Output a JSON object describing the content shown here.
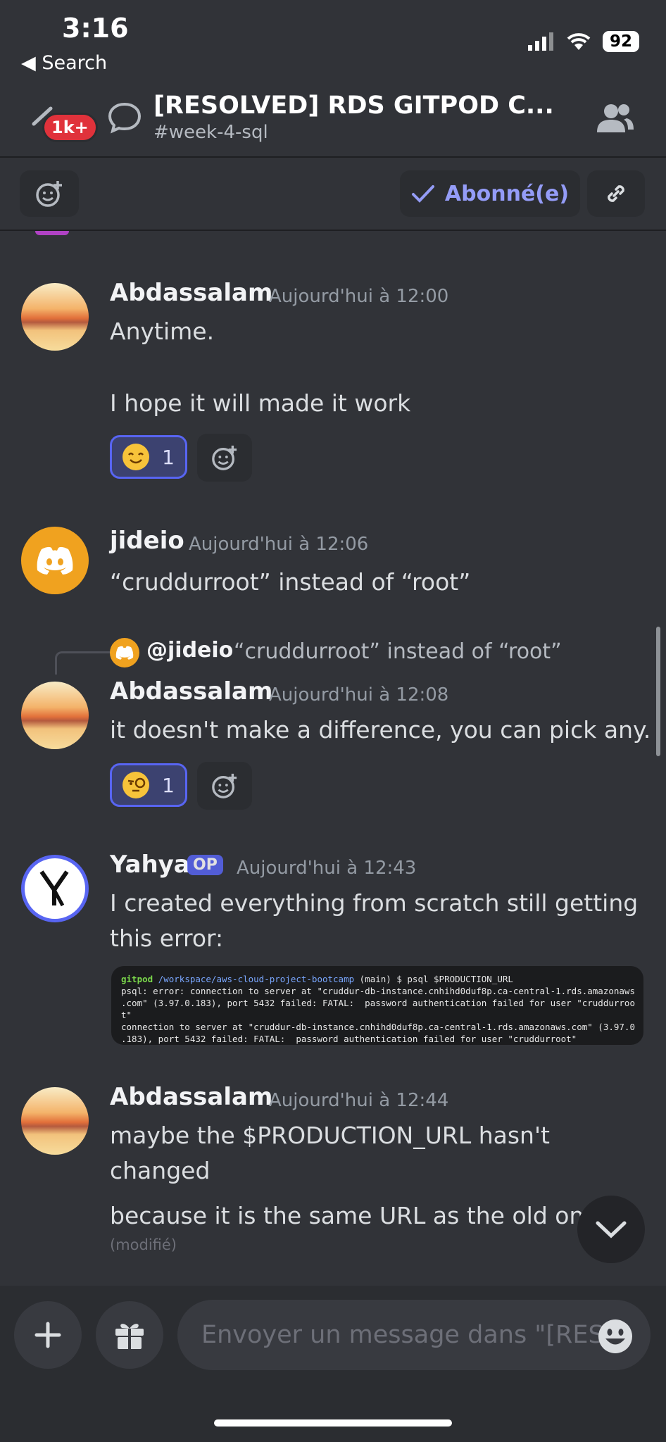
{
  "status_bar": {
    "time": "3:16",
    "back_label": "◀ Search",
    "battery": "92"
  },
  "header": {
    "title": "[RESOLVED] RDS GITPOD C...",
    "channel": "#week-4-sql",
    "badge": "1k+"
  },
  "toolbar": {
    "follow_label": "Abonné(e)"
  },
  "messages": [
    {
      "author": "Abdassalam",
      "time": "Aujourd'hui à 12:00",
      "lines": [
        "Anytime.",
        "I hope it will made it work"
      ],
      "reaction_count": "1"
    },
    {
      "author": "jideio",
      "time": "Aujourd'hui à 12:06",
      "text": "“cruddurroot” instead of “root”"
    },
    {
      "reply_mention": "@jideio",
      "reply_text": "“cruddurroot” instead of “root”",
      "author": "Abdassalam",
      "time": "Aujourd'hui à 12:08",
      "text": "it doesn't make a difference, you can pick any.",
      "reaction_count": "1"
    },
    {
      "author": "Yahya",
      "op_tag": "OP",
      "time": "Aujourd'hui à 12:43",
      "text": "I created everything from scratch still getting this error:",
      "code": {
        "prompt_user": "gitpod",
        "prompt_path": "/workspace/aws-cloud-project-bootcamp",
        "prompt_cmd": " (main) $ psql $PRODUCTION_URL",
        "line1": "psql: error: connection to server at \"cruddur-db-instance.cnhihd0duf8p.ca-central-1.rds.amazonaws",
        "line2": ".com\" (3.97.0.183), port 5432 failed: FATAL:  password authentication failed for user \"cruddurroo",
        "line3": "t\"",
        "line4": "connection to server at \"cruddur-db-instance.cnhihd0duf8p.ca-central-1.rds.amazonaws.com\" (3.97.0",
        "line5": ".183), port 5432 failed: FATAL:  password authentication failed for user \"cruddurroot\""
      }
    },
    {
      "author": "Abdassalam",
      "time": "Aujourd'hui à 12:44",
      "text": "maybe the $PRODUCTION_URL hasn't changed",
      "text2": "because it is the same URL as the old one",
      "edited": "(modifié)"
    }
  ],
  "composer": {
    "placeholder": "Envoyer un message dans \"[RES..."
  }
}
